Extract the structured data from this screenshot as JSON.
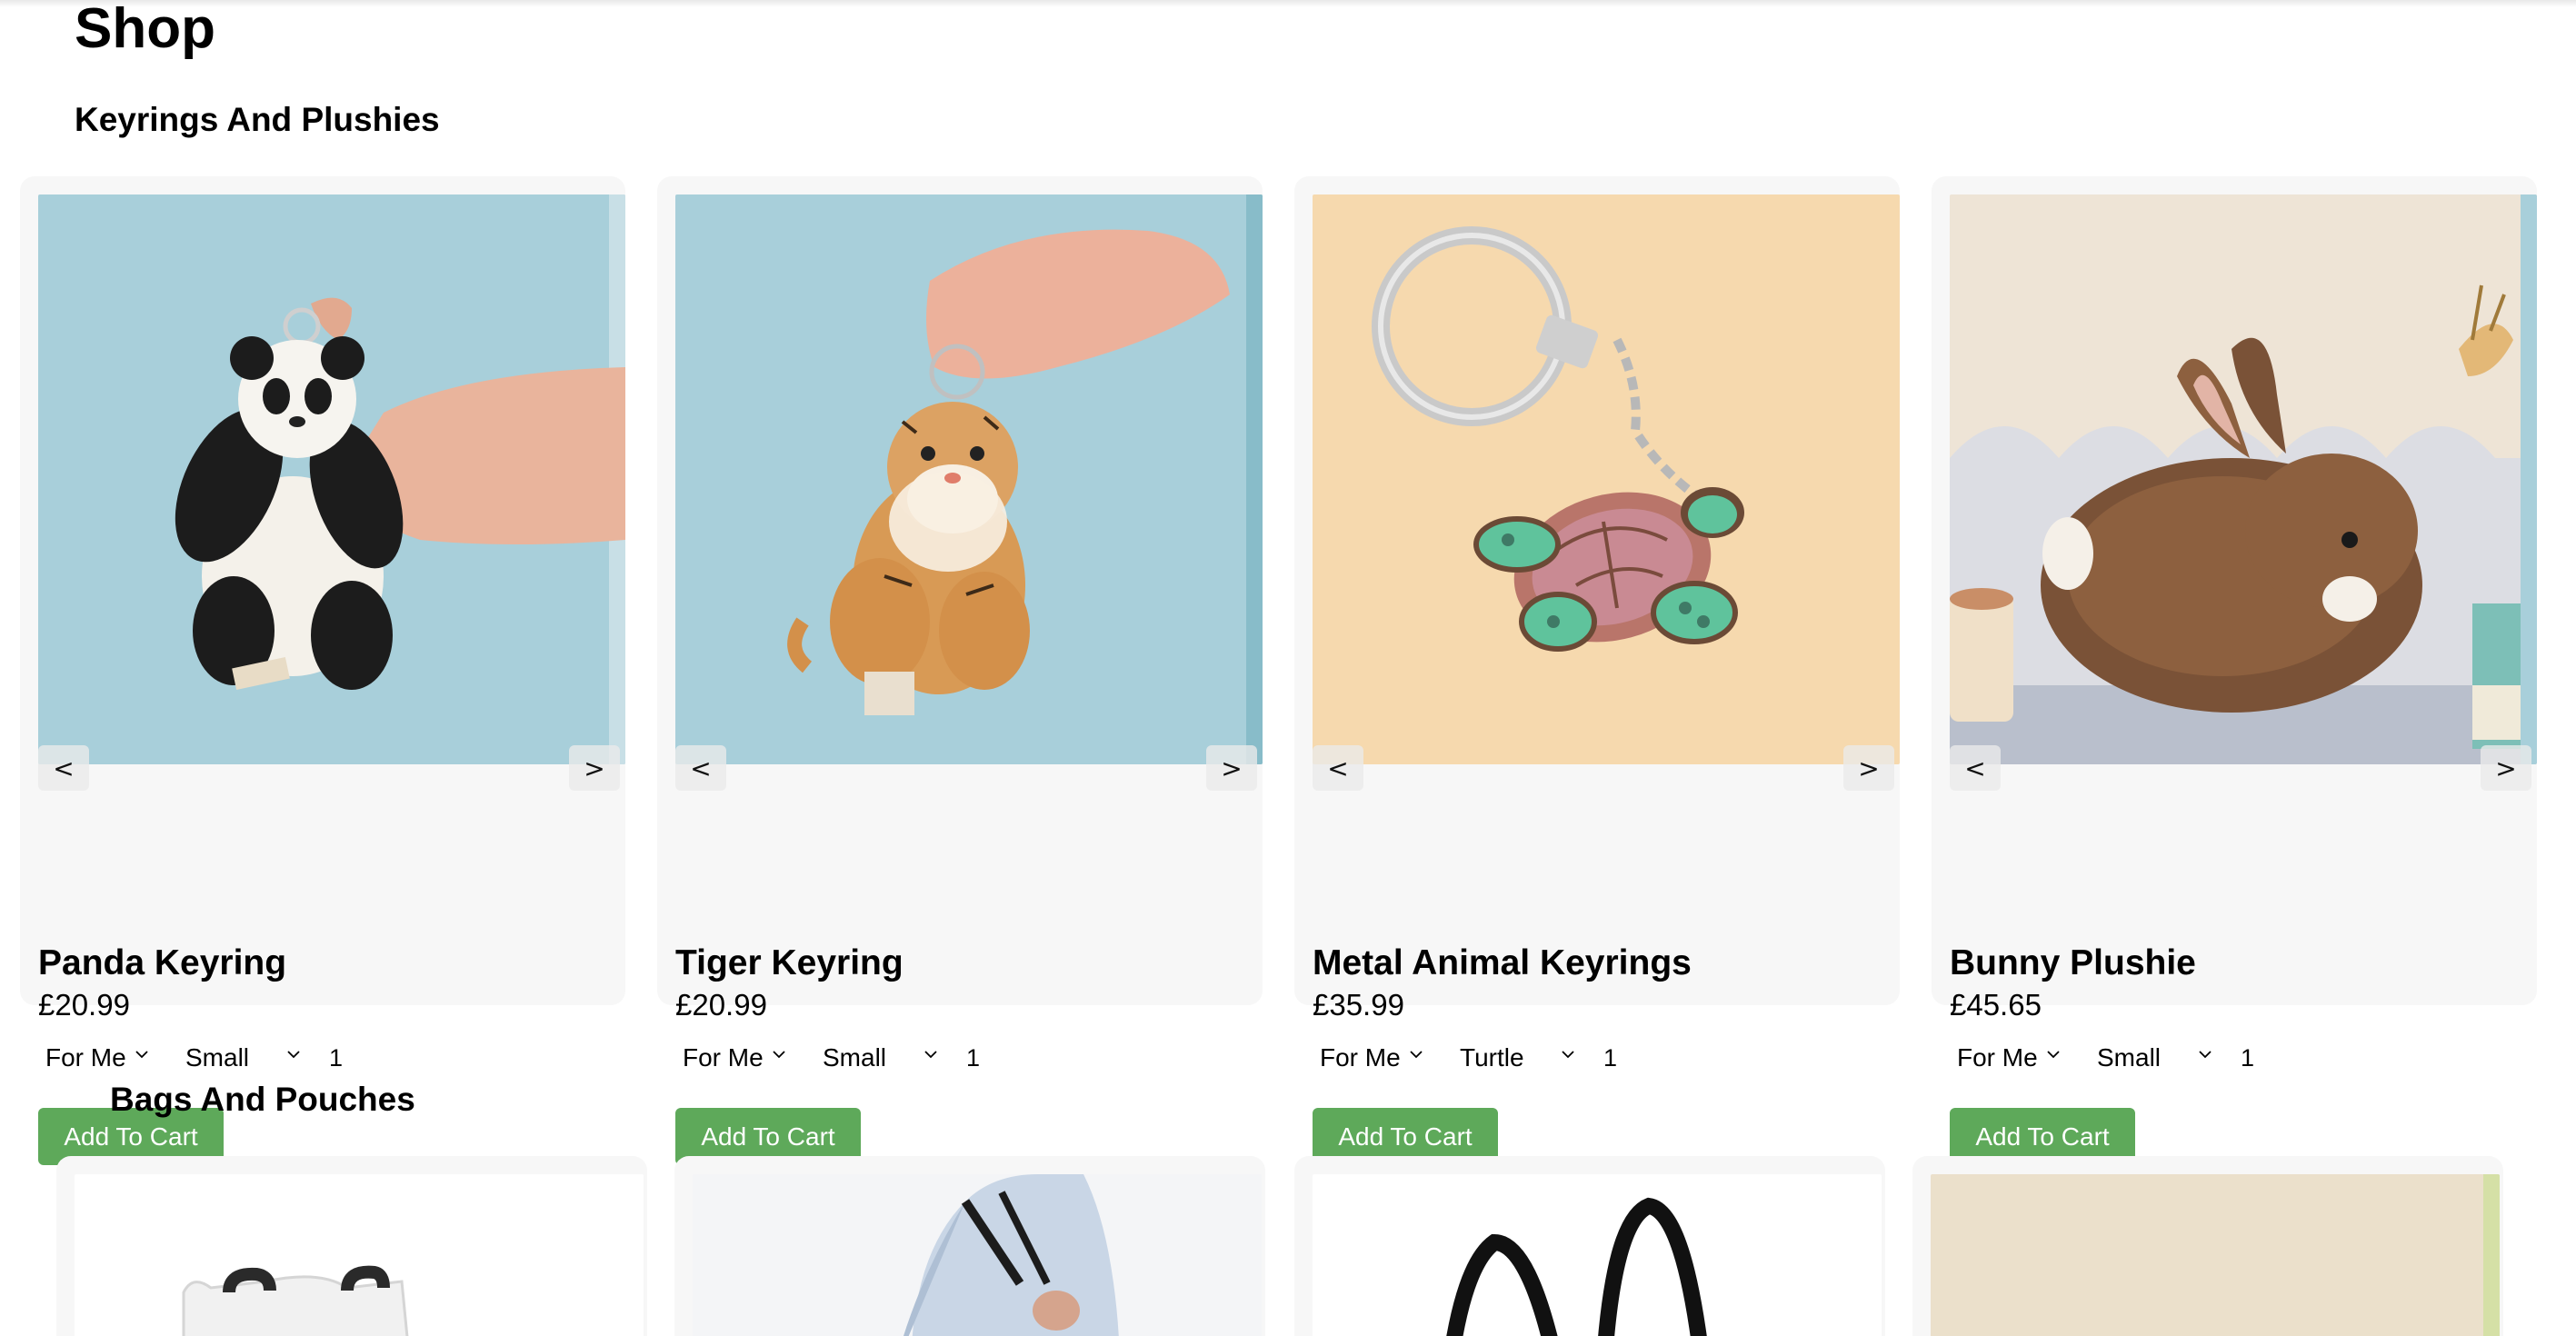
{
  "page": {
    "title": "Shop"
  },
  "sections": [
    {
      "title": "Keyrings And Plushies",
      "products": [
        {
          "name": "Panda Keyring",
          "price": "£20.99",
          "recipient": "For Me",
          "option": "Small",
          "quantity": "1",
          "cart_label": "Add To Cart",
          "prev": "<",
          "next": ">"
        },
        {
          "name": "Tiger Keyring",
          "price": "£20.99",
          "recipient": "For Me",
          "option": "Small",
          "quantity": "1",
          "cart_label": "Add To Cart",
          "prev": "<",
          "next": ">"
        },
        {
          "name": "Metal Animal Keyrings",
          "price": "£35.99",
          "recipient": "For Me",
          "option": "Turtle",
          "quantity": "1",
          "cart_label": "Add To Cart",
          "prev": "<",
          "next": ">"
        },
        {
          "name": "Bunny Plushie",
          "price": "£45.65",
          "recipient": "For Me",
          "option": "Small",
          "quantity": "1",
          "cart_label": "Add To Cart",
          "prev": "<",
          "next": ">"
        }
      ]
    },
    {
      "title": "Bags And Pouches"
    }
  ],
  "colors": {
    "accent_button": "#5ea95a",
    "card_background": "#f7f7f7",
    "blue_backdrop": "#a8cfda",
    "peach_backdrop": "#f6d9ae",
    "beige_backdrop": "#eee4d6"
  }
}
